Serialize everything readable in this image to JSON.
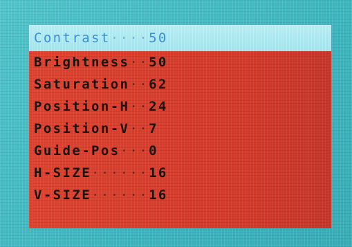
{
  "osd_menu": {
    "items": [
      {
        "label": "Contrast",
        "dots": "····",
        "value": "50"
      },
      {
        "label": "Brightness",
        "dots": "··",
        "value": "50"
      },
      {
        "label": "Saturation",
        "dots": "··",
        "value": "62"
      },
      {
        "label": "Position-H",
        "dots": "··",
        "value": "24"
      },
      {
        "label": "Position-V",
        "dots": "··",
        "value": "7"
      },
      {
        "label": "Guide-Pos",
        "dots": "···",
        "value": "0"
      },
      {
        "label": "H-SIZE",
        "dots": "······",
        "value": "16"
      },
      {
        "label": "V-SIZE",
        "dots": "······",
        "value": "16"
      }
    ],
    "selected_index": 0
  },
  "colors": {
    "background": "#44bec6",
    "menu_body": "#d93a2c",
    "selected_row_bg": "#a9eaf2",
    "selected_text": "#3c8fd6",
    "text": "#1a1410"
  }
}
